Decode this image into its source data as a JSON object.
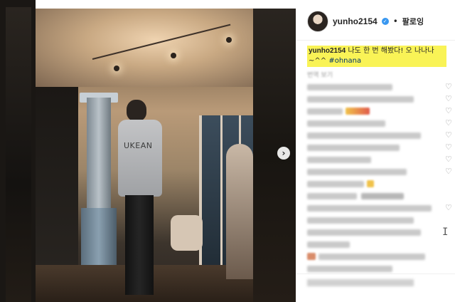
{
  "post": {
    "username": "yunho2154",
    "verified_icon": "verified-badge-icon",
    "separator": "•",
    "follow_label": "팔로잉",
    "caption": {
      "username": "yunho2154",
      "text": "나도 한 번 해봤다! 오 나나나 ~^^",
      "hashtag": "#ohnana"
    },
    "see_translation": "번역 보기",
    "next_button": "›"
  },
  "media": {
    "shirt_text": "UKEAN"
  },
  "colors": {
    "caption_highlight": "#f9f356",
    "verified_blue": "#3897f0",
    "text_primary": "#262626",
    "heart_gray": "#8e8e8e"
  }
}
